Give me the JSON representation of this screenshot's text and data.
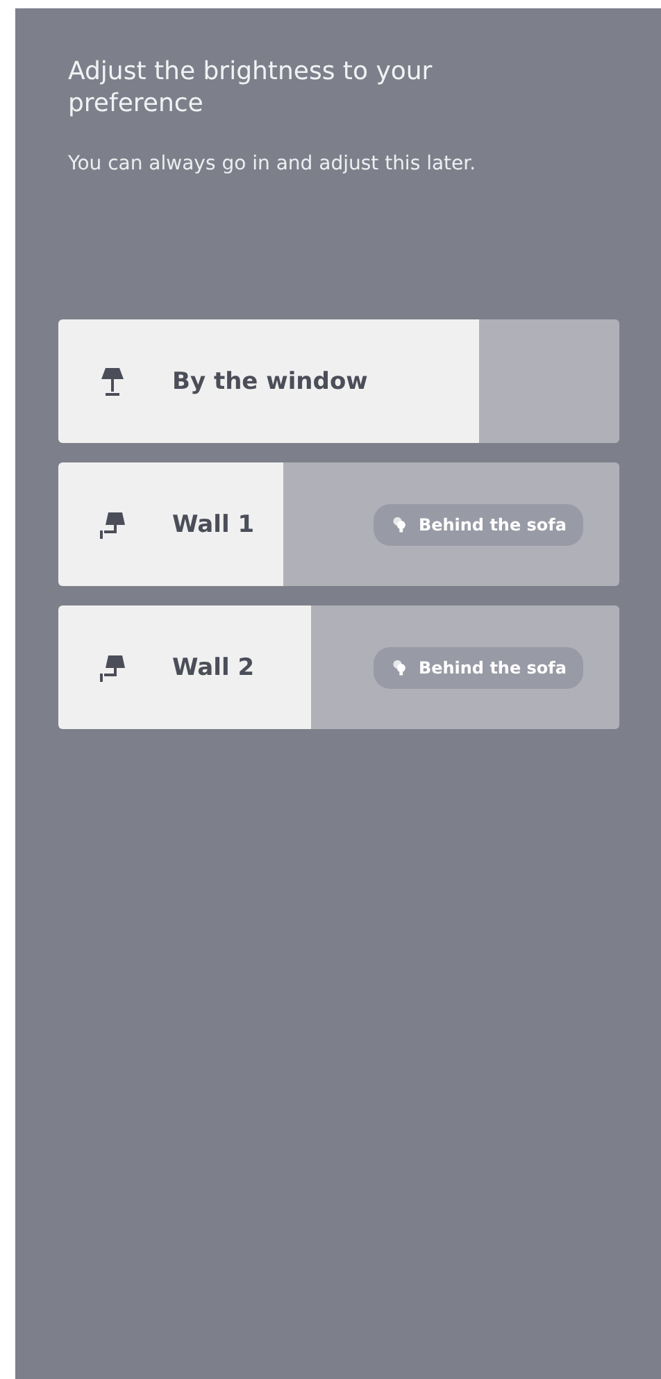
{
  "title": "Adjust the brightness to your preference",
  "subtitle": "You can always go in and adjust this later.",
  "lights": [
    {
      "name": "By the window",
      "kind": "table",
      "level": 0.75
    },
    {
      "name": "Wall 1",
      "kind": "wall",
      "level": 0.4,
      "tag": "Behind the sofa"
    },
    {
      "name": "Wall 2",
      "kind": "wall",
      "level": 0.45,
      "tag": "Behind the sofa"
    }
  ]
}
